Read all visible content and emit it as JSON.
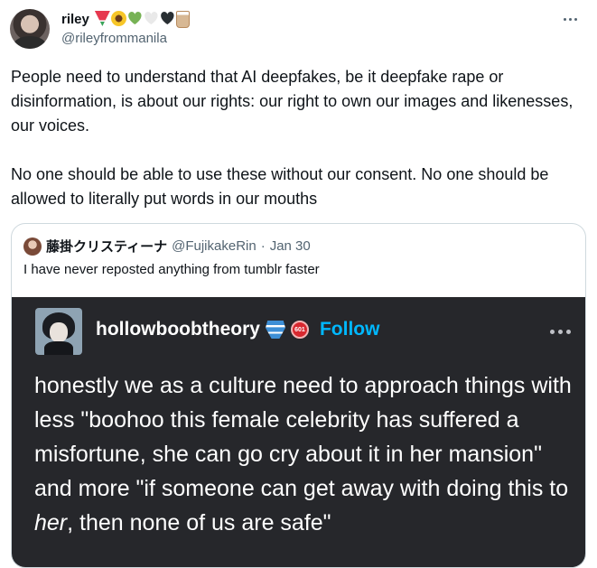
{
  "author": {
    "display_name": "riley",
    "emojis": [
      "watermelon",
      "sunflower",
      "green-heart",
      "white-heart",
      "black-heart",
      "bubble-tea"
    ],
    "handle": "@rileyfrommanila"
  },
  "tweet": {
    "paragraphs": [
      "People need to understand that AI deepfakes, be it deepfake rape or disinformation, is about our rights: our right to own our images and likenesses, our voices.",
      "No one should be able to use these without our consent. No one should be allowed to literally put words in our mouths"
    ]
  },
  "quote": {
    "display_name": "藤掛クリスティーナ",
    "handle": "@FujikakeRin",
    "separator": "·",
    "date": "Jan 30",
    "text": "I have never reposted anything from tumblr faster",
    "embed": {
      "username": "hollowboobtheory",
      "badge_text": "601",
      "follow_label": "Follow",
      "body_before": "honestly we as a culture need to approach things with less \"boohoo this female celebrity has suffered a misfortune, she can go cry about it in her mansion\" and more \"if someone can get away with doing this to ",
      "body_em": "her",
      "body_after": ", then none of us are safe\""
    }
  }
}
